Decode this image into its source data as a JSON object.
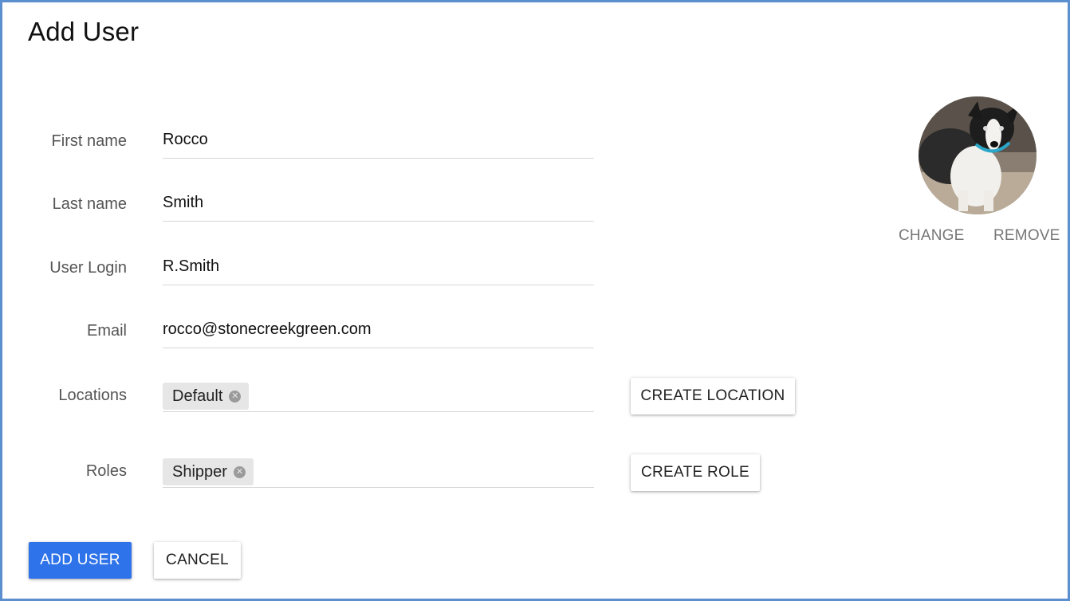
{
  "page": {
    "title": "Add User"
  },
  "form": {
    "first_name": {
      "label": "First name",
      "value": "Rocco"
    },
    "last_name": {
      "label": "Last name",
      "value": "Smith"
    },
    "login": {
      "label": "User Login",
      "value": "R.Smith"
    },
    "email": {
      "label": "Email",
      "value": "rocco@stonecreekgreen.com"
    },
    "locations": {
      "label": "Locations",
      "chips": [
        "Default"
      ],
      "create_label": "CREATE LOCATION"
    },
    "roles": {
      "label": "Roles",
      "chips": [
        "Shipper"
      ],
      "create_label": "CREATE ROLE"
    }
  },
  "avatar": {
    "change_label": "CHANGE",
    "remove_label": "REMOVE"
  },
  "actions": {
    "submit_label": "ADD USER",
    "cancel_label": "CANCEL"
  },
  "colors": {
    "accent": "#2f73ea",
    "frame_border": "#5b8fd0"
  },
  "icons": {
    "chip_remove": "close-circle-icon"
  }
}
